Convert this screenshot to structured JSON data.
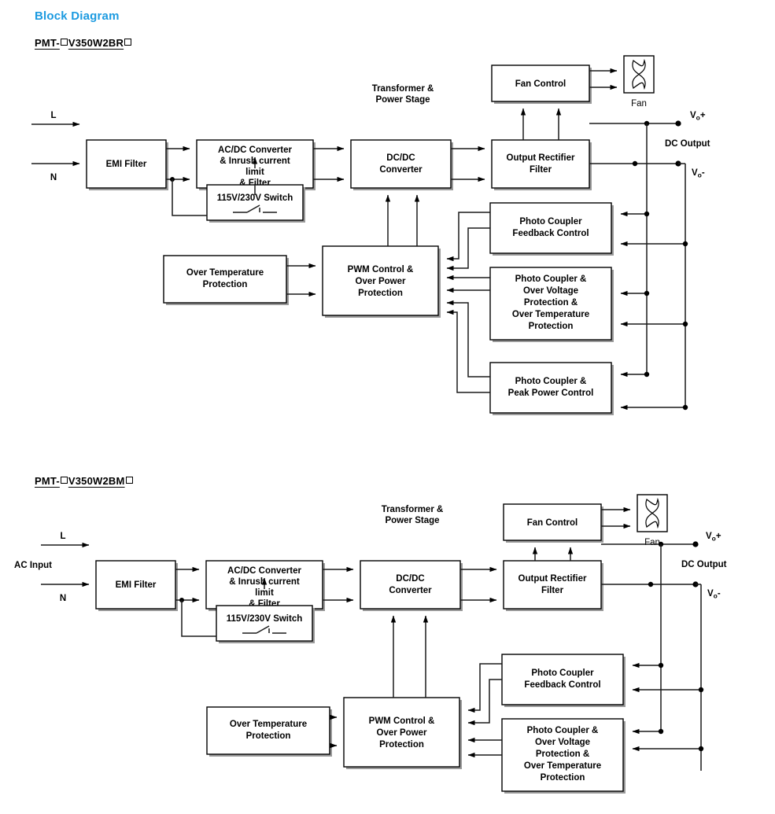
{
  "page": {
    "title": "Block Diagram",
    "title_color": "#1b9ae0"
  },
  "diagrams": [
    {
      "id": "pmt-v350w2br",
      "model_prefix": "PMT-",
      "model_mid": "V350W2BR",
      "model_suffix": "",
      "placeholder_glyph": "square",
      "input": {
        "line_label": "L",
        "neutral_label": "N",
        "ac_input_label": ""
      },
      "blocks": {
        "emi_filter": "EMI Filter",
        "acdc_converter": "AC/DC Converter\n& Inrush current\nlimit\n& Filter",
        "voltage_switch": "115V/230V Switch",
        "dcdc_converter": "DC/DC\nConverter",
        "transformer_caption": "Transformer &\nPower Stage",
        "output_rectifier": "Output Rectifier\nFilter",
        "fan_control": "Fan Control",
        "fan_label": "Fan",
        "pwm_control": "PWM Control &\nOver Power\nProtection",
        "over_temp": "Over Temperature\nProtection",
        "photo_feedback": "Photo Coupler\nFeedback Control",
        "photo_ovp": "Photo Coupler &\nOver Voltage\nProtection &\nOver Temperature\nProtection",
        "photo_peak": "Photo Coupler &\nPeak Power Control"
      },
      "output": {
        "vo_plus": "V",
        "vo_plus_sub": "o",
        "vo_plus_sign": "+",
        "vo_minus": "V",
        "vo_minus_sub": "o",
        "vo_minus_sign": "-",
        "dc_output_label": "DC Output"
      }
    },
    {
      "id": "pmt-v350w2bm",
      "model_prefix": "PMT-",
      "model_mid": "V350W2BM",
      "model_suffix": "",
      "placeholder_glyph": "square",
      "input": {
        "line_label": "L",
        "neutral_label": "N",
        "ac_input_label": "AC Input"
      },
      "blocks": {
        "emi_filter": "EMI Filter",
        "acdc_converter": "AC/DC Converter\n& Inrush current\nlimit\n& Filter",
        "voltage_switch": "115V/230V Switch",
        "dcdc_converter": "DC/DC\nConverter",
        "transformer_caption": "Transformer &\nPower Stage",
        "output_rectifier": "Output Rectifier\nFilter",
        "fan_control": "Fan Control",
        "fan_label": "Fan",
        "pwm_control": "PWM Control &\nOver Power\nProtection",
        "over_temp": "Over Temperature\nProtection",
        "photo_feedback": "Photo Coupler\nFeedback Control",
        "photo_ovp": "Photo Coupler &\nOver Voltage\nProtection &\nOver Temperature\nProtection"
      },
      "output": {
        "vo_plus": "V",
        "vo_plus_sub": "o",
        "vo_plus_sign": "+",
        "vo_minus": "V",
        "vo_minus_sub": "o",
        "vo_minus_sign": "-",
        "dc_output_label": "DC Output"
      }
    }
  ]
}
